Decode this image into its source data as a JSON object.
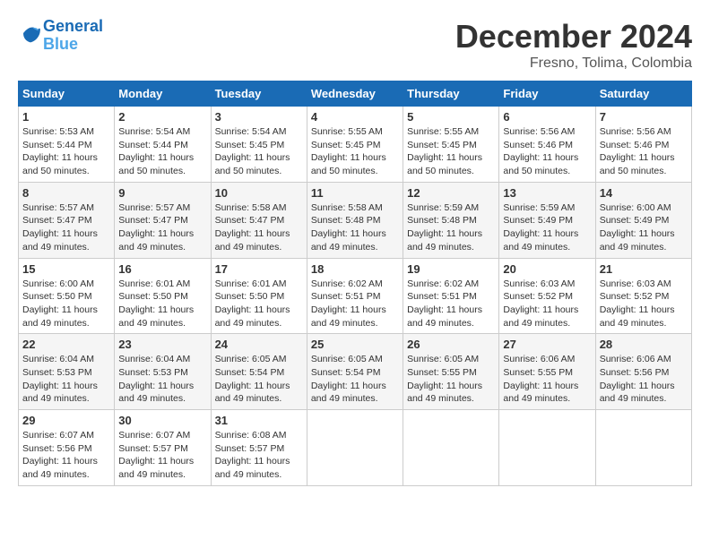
{
  "logo": {
    "line1": "General",
    "line2": "Blue"
  },
  "title": "December 2024",
  "location": "Fresno, Tolima, Colombia",
  "days_of_week": [
    "Sunday",
    "Monday",
    "Tuesday",
    "Wednesday",
    "Thursday",
    "Friday",
    "Saturday"
  ],
  "weeks": [
    [
      {
        "day": "1",
        "sunrise": "5:53 AM",
        "sunset": "5:44 PM",
        "daylight": "11 hours and 50 minutes."
      },
      {
        "day": "2",
        "sunrise": "5:54 AM",
        "sunset": "5:44 PM",
        "daylight": "11 hours and 50 minutes."
      },
      {
        "day": "3",
        "sunrise": "5:54 AM",
        "sunset": "5:45 PM",
        "daylight": "11 hours and 50 minutes."
      },
      {
        "day": "4",
        "sunrise": "5:55 AM",
        "sunset": "5:45 PM",
        "daylight": "11 hours and 50 minutes."
      },
      {
        "day": "5",
        "sunrise": "5:55 AM",
        "sunset": "5:45 PM",
        "daylight": "11 hours and 50 minutes."
      },
      {
        "day": "6",
        "sunrise": "5:56 AM",
        "sunset": "5:46 PM",
        "daylight": "11 hours and 50 minutes."
      },
      {
        "day": "7",
        "sunrise": "5:56 AM",
        "sunset": "5:46 PM",
        "daylight": "11 hours and 50 minutes."
      }
    ],
    [
      {
        "day": "8",
        "sunrise": "5:57 AM",
        "sunset": "5:47 PM",
        "daylight": "11 hours and 49 minutes."
      },
      {
        "day": "9",
        "sunrise": "5:57 AM",
        "sunset": "5:47 PM",
        "daylight": "11 hours and 49 minutes."
      },
      {
        "day": "10",
        "sunrise": "5:58 AM",
        "sunset": "5:47 PM",
        "daylight": "11 hours and 49 minutes."
      },
      {
        "day": "11",
        "sunrise": "5:58 AM",
        "sunset": "5:48 PM",
        "daylight": "11 hours and 49 minutes."
      },
      {
        "day": "12",
        "sunrise": "5:59 AM",
        "sunset": "5:48 PM",
        "daylight": "11 hours and 49 minutes."
      },
      {
        "day": "13",
        "sunrise": "5:59 AM",
        "sunset": "5:49 PM",
        "daylight": "11 hours and 49 minutes."
      },
      {
        "day": "14",
        "sunrise": "6:00 AM",
        "sunset": "5:49 PM",
        "daylight": "11 hours and 49 minutes."
      }
    ],
    [
      {
        "day": "15",
        "sunrise": "6:00 AM",
        "sunset": "5:50 PM",
        "daylight": "11 hours and 49 minutes."
      },
      {
        "day": "16",
        "sunrise": "6:01 AM",
        "sunset": "5:50 PM",
        "daylight": "11 hours and 49 minutes."
      },
      {
        "day": "17",
        "sunrise": "6:01 AM",
        "sunset": "5:50 PM",
        "daylight": "11 hours and 49 minutes."
      },
      {
        "day": "18",
        "sunrise": "6:02 AM",
        "sunset": "5:51 PM",
        "daylight": "11 hours and 49 minutes."
      },
      {
        "day": "19",
        "sunrise": "6:02 AM",
        "sunset": "5:51 PM",
        "daylight": "11 hours and 49 minutes."
      },
      {
        "day": "20",
        "sunrise": "6:03 AM",
        "sunset": "5:52 PM",
        "daylight": "11 hours and 49 minutes."
      },
      {
        "day": "21",
        "sunrise": "6:03 AM",
        "sunset": "5:52 PM",
        "daylight": "11 hours and 49 minutes."
      }
    ],
    [
      {
        "day": "22",
        "sunrise": "6:04 AM",
        "sunset": "5:53 PM",
        "daylight": "11 hours and 49 minutes."
      },
      {
        "day": "23",
        "sunrise": "6:04 AM",
        "sunset": "5:53 PM",
        "daylight": "11 hours and 49 minutes."
      },
      {
        "day": "24",
        "sunrise": "6:05 AM",
        "sunset": "5:54 PM",
        "daylight": "11 hours and 49 minutes."
      },
      {
        "day": "25",
        "sunrise": "6:05 AM",
        "sunset": "5:54 PM",
        "daylight": "11 hours and 49 minutes."
      },
      {
        "day": "26",
        "sunrise": "6:05 AM",
        "sunset": "5:55 PM",
        "daylight": "11 hours and 49 minutes."
      },
      {
        "day": "27",
        "sunrise": "6:06 AM",
        "sunset": "5:55 PM",
        "daylight": "11 hours and 49 minutes."
      },
      {
        "day": "28",
        "sunrise": "6:06 AM",
        "sunset": "5:56 PM",
        "daylight": "11 hours and 49 minutes."
      }
    ],
    [
      {
        "day": "29",
        "sunrise": "6:07 AM",
        "sunset": "5:56 PM",
        "daylight": "11 hours and 49 minutes."
      },
      {
        "day": "30",
        "sunrise": "6:07 AM",
        "sunset": "5:57 PM",
        "daylight": "11 hours and 49 minutes."
      },
      {
        "day": "31",
        "sunrise": "6:08 AM",
        "sunset": "5:57 PM",
        "daylight": "11 hours and 49 minutes."
      },
      null,
      null,
      null,
      null
    ]
  ],
  "labels": {
    "sunrise": "Sunrise:",
    "sunset": "Sunset:",
    "daylight": "Daylight:"
  }
}
